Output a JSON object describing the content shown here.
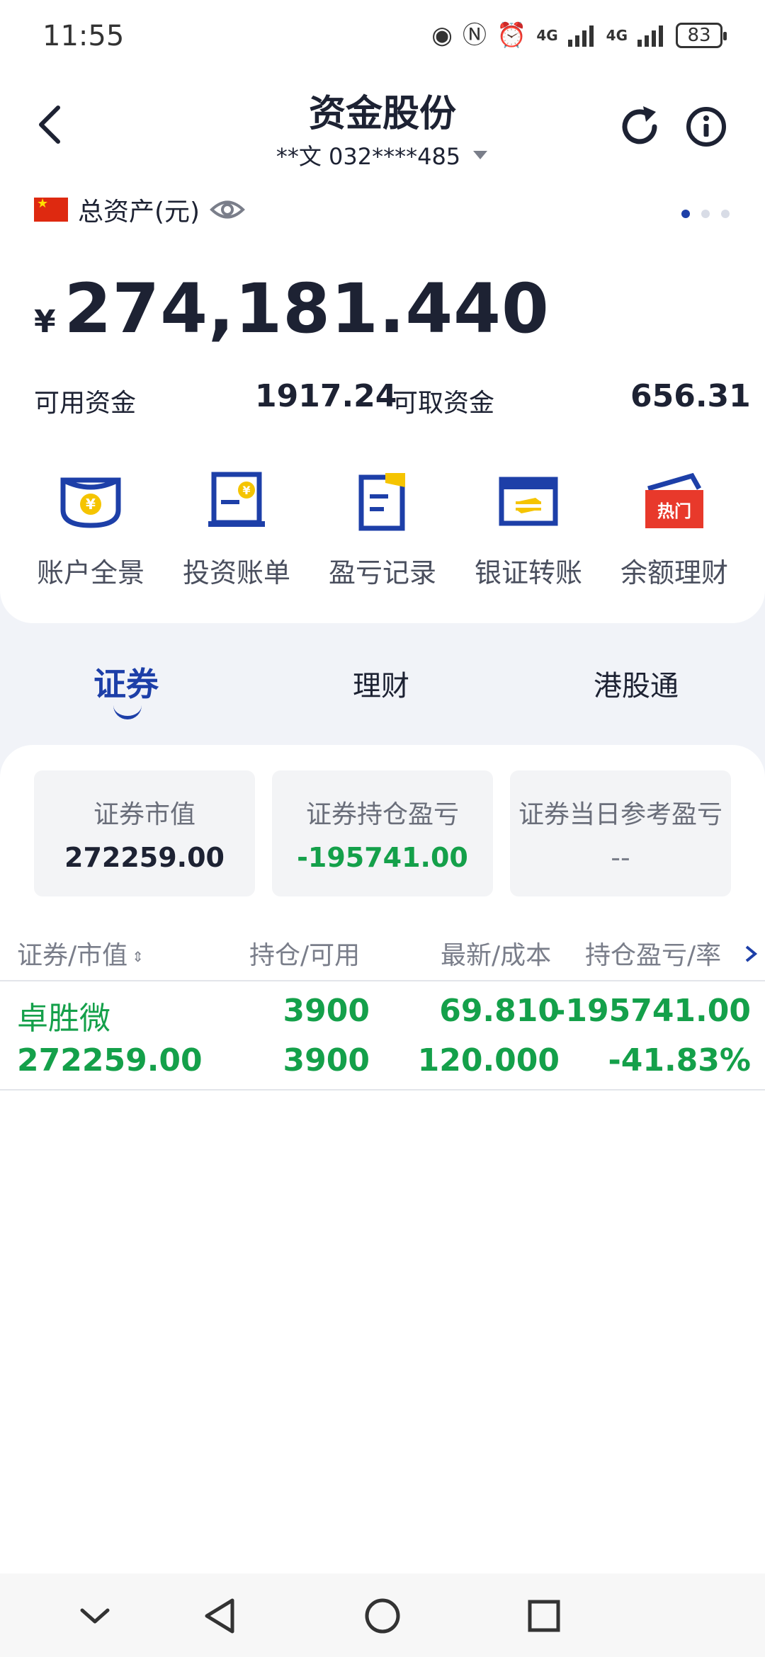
{
  "status_bar": {
    "time": "11:55",
    "battery": "83",
    "net1": "4G",
    "net2": "4G"
  },
  "header": {
    "title": "资金股份",
    "account": "**文 032****485"
  },
  "asset": {
    "label": "总资产(元)",
    "currency": "¥",
    "total": "274,181.440"
  },
  "funds": {
    "available_label": "可用资金",
    "available_value": "1917.24",
    "withdrawable_label": "可取资金",
    "withdrawable_value": "656.31"
  },
  "quick_actions": [
    {
      "label": "账户全景",
      "icon": "account-overview-icon"
    },
    {
      "label": "投资账单",
      "icon": "invest-bill-icon"
    },
    {
      "label": "盈亏记录",
      "icon": "pnl-record-icon"
    },
    {
      "label": "银证转账",
      "icon": "bank-transfer-icon"
    },
    {
      "label": "余额理财",
      "icon": "balance-wealth-icon",
      "badge": "热门"
    }
  ],
  "tabs": [
    {
      "label": "证券",
      "active": true
    },
    {
      "label": "理财"
    },
    {
      "label": "港股通"
    }
  ],
  "summary_cards": [
    {
      "label": "证券市值",
      "value": "272259.00"
    },
    {
      "label": "证券持仓盈亏",
      "value": "-195741.00"
    },
    {
      "label": "证券当日参考盈亏",
      "value": "--"
    }
  ],
  "table": {
    "headers": [
      "证券/市值",
      "持仓/可用",
      "最新/成本",
      "持仓盈亏/率"
    ],
    "rows": [
      {
        "name": "卓胜微",
        "market_value": "272259.00",
        "position": "3900",
        "available": "3900",
        "latest": "69.810",
        "cost": "120.000",
        "pnl": "-195741.00",
        "pnl_rate": "-41.83%"
      }
    ]
  },
  "colors": {
    "brand": "#1d3fa8",
    "loss": "#14a04a",
    "hot": "#e8392b"
  }
}
